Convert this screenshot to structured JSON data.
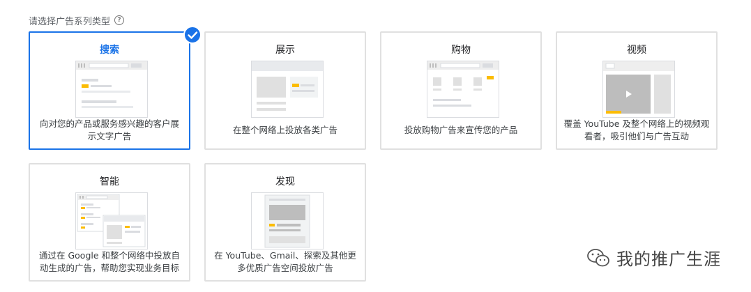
{
  "prompt": {
    "label": "请选择广告系列类型",
    "help_icon": "question-circle-icon"
  },
  "campaign_types": [
    {
      "title": "搜索",
      "description": "向对您的产品或服务感兴趣的客户展示文字广告",
      "selected": true
    },
    {
      "title": "展示",
      "description": "在整个网络上投放各类广告",
      "selected": false
    },
    {
      "title": "购物",
      "description": "投放购物广告来宣传您的产品",
      "selected": false
    },
    {
      "title": "视频",
      "description": "覆盖 YouTube 及整个网络上的视频观看者，吸引他们与广告互动",
      "selected": false
    },
    {
      "title": "智能",
      "description": "通过在 Google 和整个网络中投放自动生成的广告，帮助您实现业务目标",
      "selected": false
    },
    {
      "title": "发现",
      "description": "在 YouTube、Gmail、探索及其他更多优质广告空间投放广告",
      "selected": false
    }
  ],
  "watermark": {
    "text": "我的推广生涯",
    "icon": "wechat-icon"
  },
  "colors": {
    "accent": "#1a73e8",
    "highlight": "#fbbc04",
    "border": "#e0e0e0"
  }
}
